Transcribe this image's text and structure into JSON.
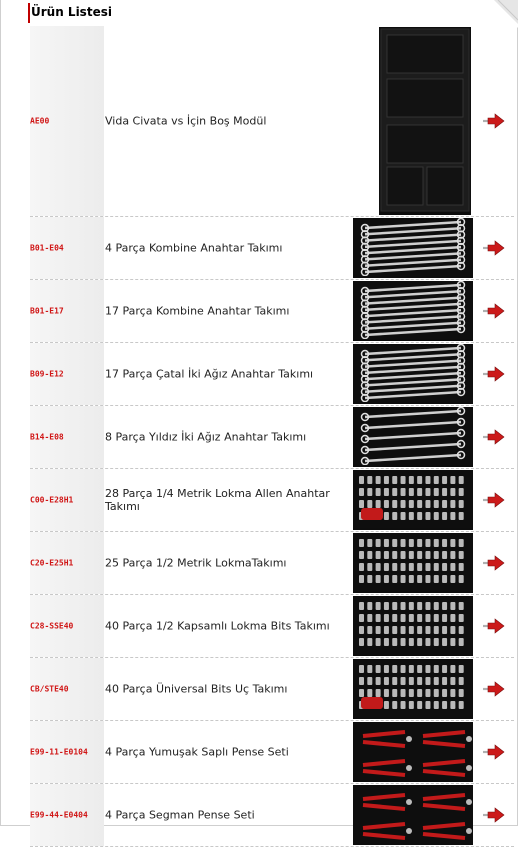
{
  "header": {
    "title": "Ürün Listesi"
  },
  "products": [
    {
      "code": "AE00",
      "name": "Vida Civata vs İçin Boş Modül",
      "image": "empty-module-tray-image"
    },
    {
      "code": "B01-E04",
      "name": "4 Parça Kombine Anahtar Takımı",
      "image": "combination-wrench-set-image"
    },
    {
      "code": "B01-E17",
      "name": "17 Parça Kombine Anahtar Takımı",
      "image": "combination-wrench-set-image"
    },
    {
      "code": "B09-E12",
      "name": "17 Parça Çatal İki Ağız Anahtar Takımı",
      "image": "open-end-wrench-set-image"
    },
    {
      "code": "B14-E08",
      "name": "8 Parça Yıldız İki Ağız Anahtar Takımı",
      "image": "ring-wrench-set-image"
    },
    {
      "code": "C00-E28H1",
      "name": "28 Parça 1/4 Metrik Lokma Allen Anahtar Takımı",
      "image": "socket-allen-set-image"
    },
    {
      "code": "C20-E25H1",
      "name": "25 Parça 1/2 Metrik LokmaTakımı",
      "image": "socket-set-image"
    },
    {
      "code": "C28-SSE40",
      "name": "40 Parça 1/2 Kapsamlı Lokma Bits Takımı",
      "image": "socket-bits-set-image"
    },
    {
      "code": "CB/STE40",
      "name": "40 Parça Üniversal Bits Uç Takımı",
      "image": "bits-set-image"
    },
    {
      "code": "E99-11-E0104",
      "name": "4 Parça Yumuşak Saplı Pense Seti",
      "image": "pliers-set-image"
    },
    {
      "code": "E99-44-E0404",
      "name": "4 Parça Segman Pense Seti",
      "image": "circlip-pliers-set-image"
    }
  ],
  "colors": {
    "accent": "#c00000",
    "code_text": "#d01515",
    "arrow": "#cc1a1a"
  }
}
